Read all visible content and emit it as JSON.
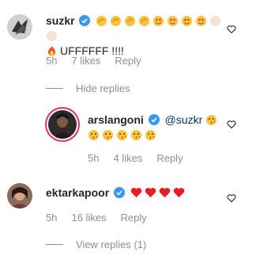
{
  "comments": [
    {
      "username": "suzkr",
      "text_suffix": "UFFFFFF !!!!",
      "time": "5h",
      "likes": "7 likes",
      "reply_label": "Reply"
    },
    {
      "username": "arslangoni",
      "mention": "@suzkr",
      "time": "5h",
      "likes": "4 likes",
      "reply_label": "Reply"
    },
    {
      "username": "ektarkapoor",
      "time": "5h",
      "likes": "16 likes",
      "reply_label": "Reply"
    }
  ],
  "hide_replies_label": "Hide replies",
  "view_replies_label": "View replies (1)",
  "colors": {
    "verified": "#3897f0",
    "heart_red": "#ed1c24",
    "muted": "#8e8e8e"
  }
}
